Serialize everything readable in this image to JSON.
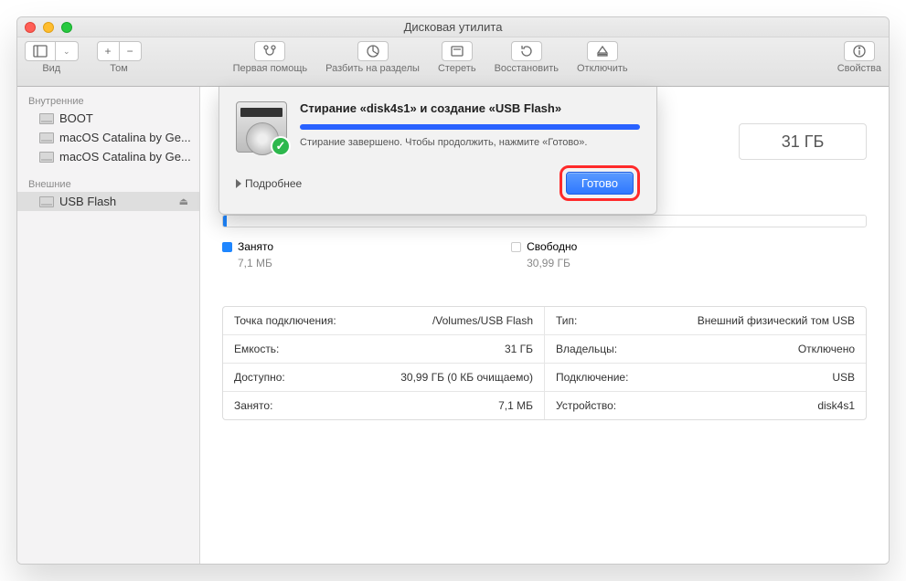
{
  "title": "Дисковая утилита",
  "toolbar": {
    "view": "Вид",
    "volume": "Том",
    "first_aid": "Первая помощь",
    "partition": "Разбить на разделы",
    "erase": "Стереть",
    "restore": "Восстановить",
    "unmount": "Отключить",
    "info": "Свойства"
  },
  "sidebar": {
    "internal_header": "Внутренние",
    "external_header": "Внешние",
    "internal": [
      {
        "label": "BOOT"
      },
      {
        "label": "macOS Catalina by Ge..."
      },
      {
        "label": "macOS Catalina by Ge..."
      }
    ],
    "external": [
      {
        "label": "USB Flash"
      }
    ]
  },
  "capacity_box": "31 ГБ",
  "usage": {
    "used_label": "Занято",
    "used_value": "7,1 МБ",
    "free_label": "Свободно",
    "free_value": "30,99 ГБ"
  },
  "info": {
    "mount_label": "Точка подключения:",
    "mount_value": "/Volumes/USB Flash",
    "type_label": "Тип:",
    "type_value": "Внешний физический том USB",
    "capacity_label": "Емкость:",
    "capacity_value": "31 ГБ",
    "owners_label": "Владельцы:",
    "owners_value": "Отключено",
    "available_label": "Доступно:",
    "available_value": "30,99 ГБ (0 КБ очищаемо)",
    "connection_label": "Подключение:",
    "connection_value": "USB",
    "used_label": "Занято:",
    "used_value": "7,1 МБ",
    "device_label": "Устройство:",
    "device_value": "disk4s1"
  },
  "sheet": {
    "title": "Стирание «disk4s1» и создание «USB Flash»",
    "message": "Стирание завершено. Чтобы продолжить, нажмите «Готово».",
    "details": "Подробнее",
    "done": "Готово"
  }
}
